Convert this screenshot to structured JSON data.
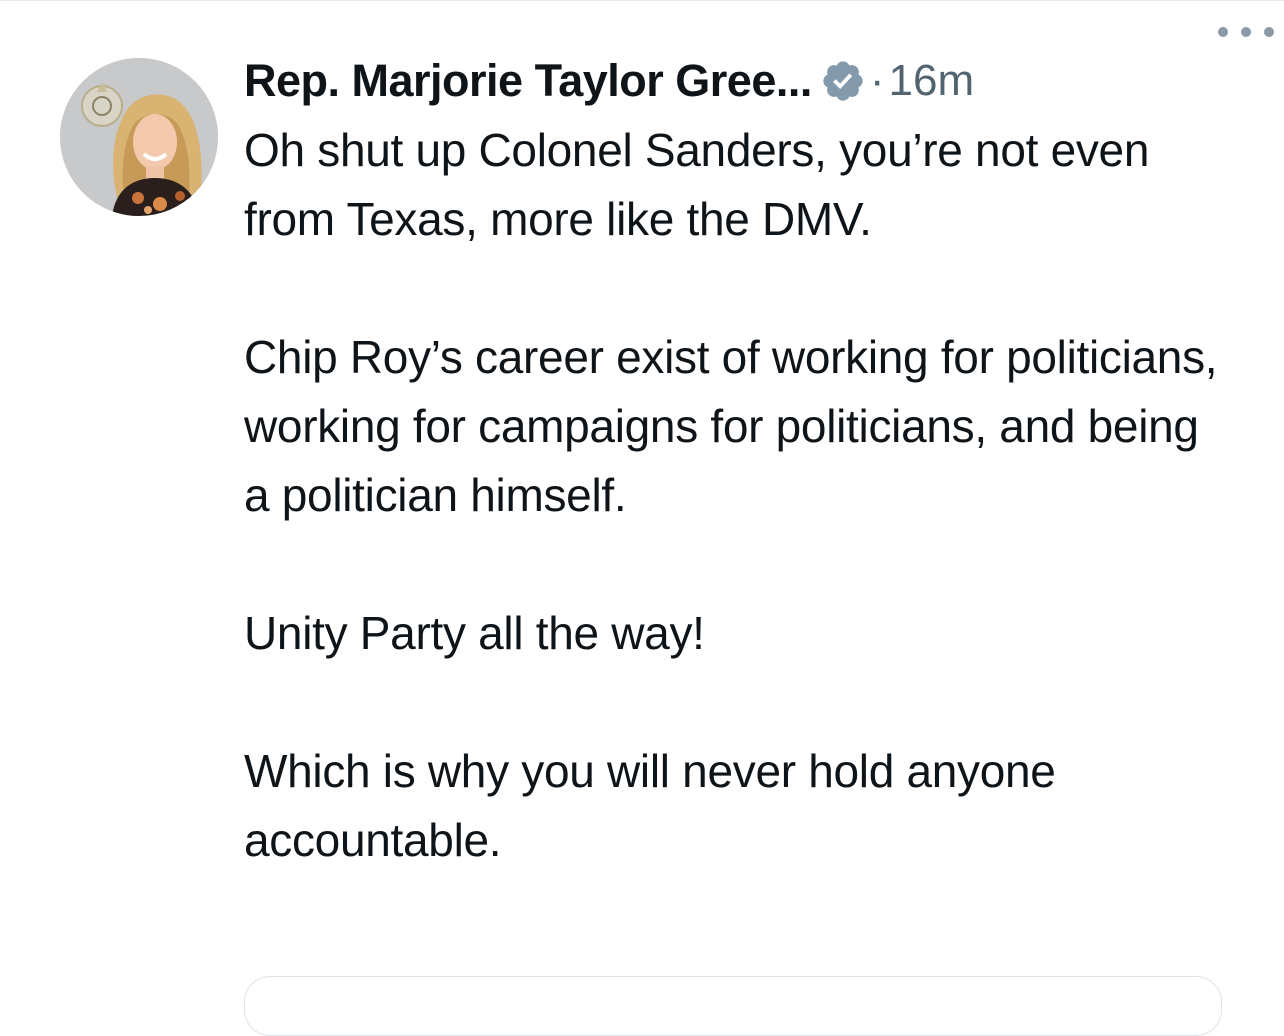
{
  "tweet": {
    "display_name": "Rep. Marjorie Taylor Gree...",
    "verified_icon": "verified-badge-icon",
    "separator": "·",
    "timestamp": "16m",
    "more_icon": "more-options-icon",
    "avatar_icon": "profile-avatar",
    "paragraphs": [
      "Oh shut up Colonel Sanders, you’re not even from Texas, more like the DMV.",
      "Chip Roy’s career exist of working for politicians, working for campaigns for politicians, and being a politician himself.",
      "Unity Party all the way!",
      "Which is why you will never hold anyone accountable."
    ]
  },
  "colors": {
    "text": "#0f1419",
    "secondary": "#536471",
    "badge": "#829aab",
    "divider": "#e6e9eb"
  }
}
